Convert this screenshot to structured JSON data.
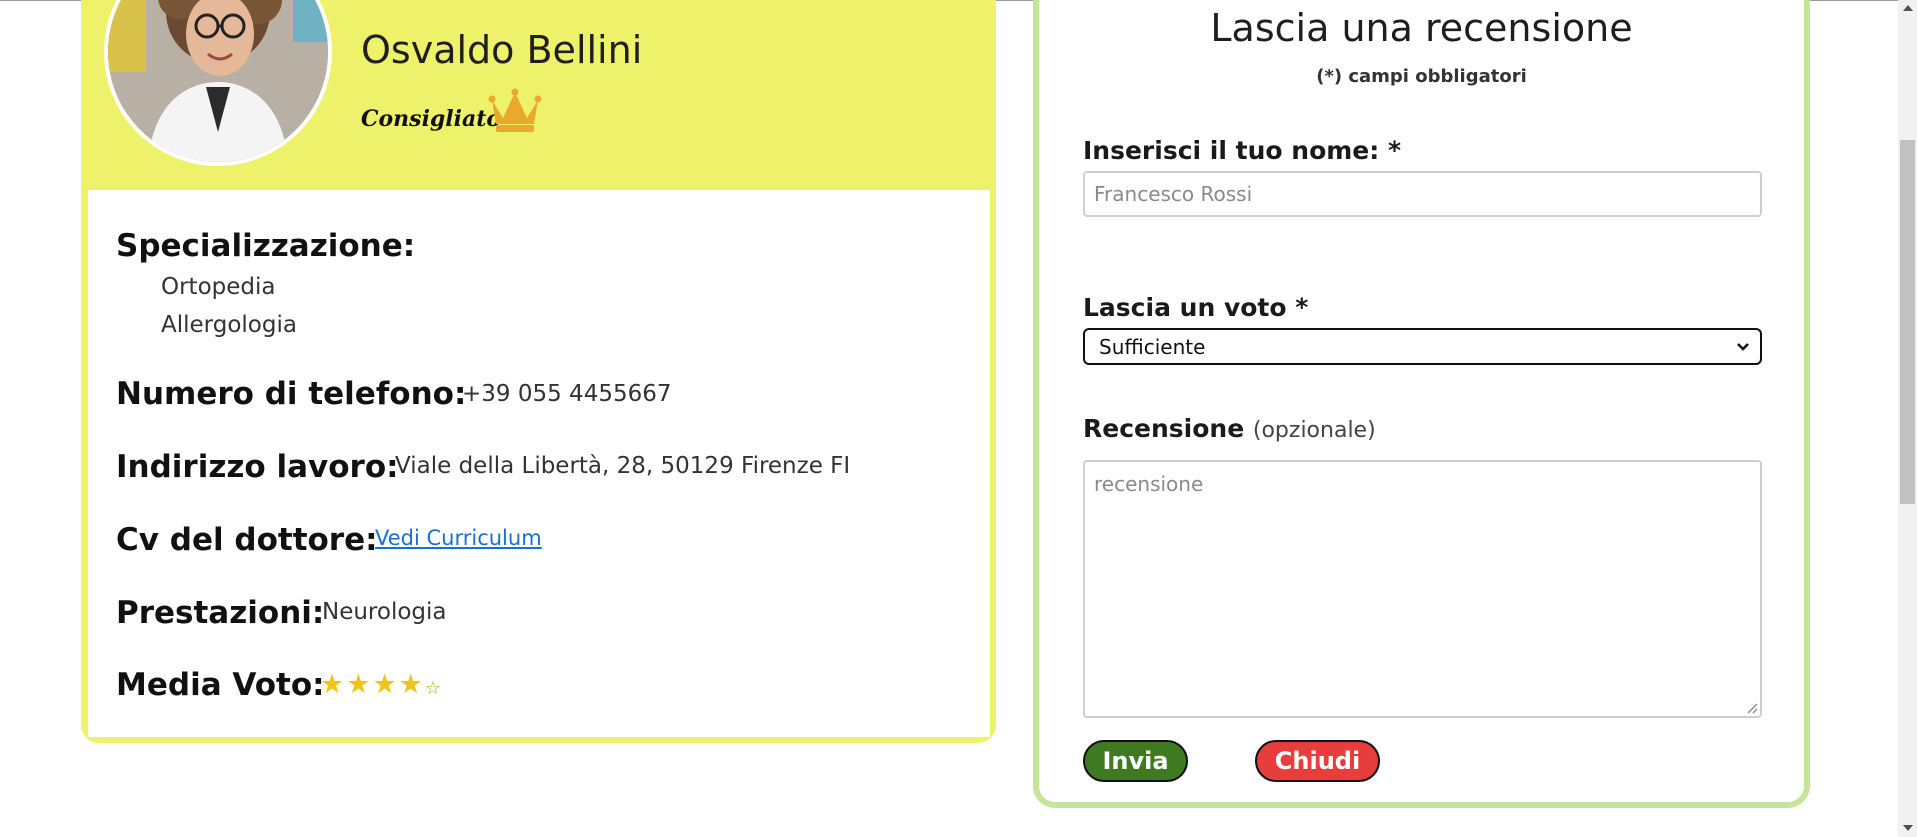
{
  "doctor": {
    "name": "Osvaldo Bellini",
    "badge": "Consigliato",
    "specialization_label": "Specializzazione:",
    "specializations": [
      "Ortopedia",
      "Allergologia"
    ],
    "phone_label": "Numero di telefono:",
    "phone": "+39 055 4455667",
    "address_label": "Indirizzo lavoro:",
    "address": "Viale della Libertà, 28, 50129 Firenze FI",
    "cv_label": "Cv del dottore:",
    "cv_link": "Vedi Curriculum",
    "services_label": "Prestazioni:",
    "services": "Neurologia",
    "rating_label": "Media Voto:",
    "rating_filled": 4,
    "rating_max": 5
  },
  "review_form": {
    "title": "Lascia una recensione",
    "required_note": "(*) campi obbligatori",
    "name_label": "Inserisci il tuo nome: *",
    "name_placeholder": "Francesco Rossi",
    "vote_label": "Lascia un voto *",
    "vote_selected": "Sufficiente",
    "review_label": "Recensione",
    "review_optional": "(opzionale)",
    "review_placeholder": "recensione",
    "submit_label": "Invia",
    "close_label": "Chiudi"
  },
  "colors": {
    "card_yellow": "#eef26a",
    "form_border_green": "#c4e59a",
    "submit_green": "#3f7a22",
    "close_red": "#e83d3d",
    "star_gold": "#f0c419",
    "crown_gold": "#e9a92c",
    "link_blue": "#1a6fd6"
  },
  "icons": {
    "badge_icon": "crown-icon",
    "rating_icon": "star-icon",
    "select_icon": "chevron-down-icon"
  }
}
